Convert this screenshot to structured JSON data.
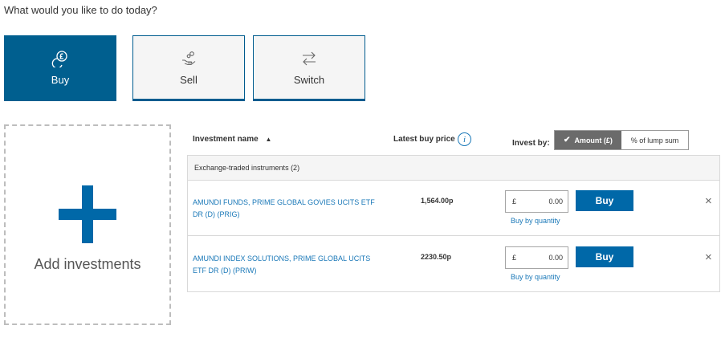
{
  "prompt": "What would you like to do today?",
  "actions": {
    "buy": {
      "label": "Buy",
      "icon": "coin-pound-icon",
      "active": true
    },
    "sell": {
      "label": "Sell",
      "icon": "hand-coins-icon"
    },
    "switch": {
      "label": "Switch",
      "icon": "swap-arrows-icon"
    }
  },
  "add_investments": {
    "label": "Add investments",
    "icon": "plus-icon"
  },
  "table": {
    "headers": {
      "name": "Investment name",
      "sort_indicator": "▲",
      "price": "Latest buy price",
      "info": "i",
      "invest_by": "Invest by:"
    },
    "toggle": {
      "amount": "Amount (£)",
      "percent": "% of lump sum"
    },
    "group_label": "Exchange-traded instruments (2)",
    "rows": [
      {
        "name": "AMUNDI FUNDS, PRIME GLOBAL GOVIES UCITS ETF DR (D) (PRIG)",
        "price": "1,564.00p",
        "currency": "£",
        "amount": "0.00",
        "qty_link": "Buy by quantity",
        "buy_label": "Buy",
        "remove": "×"
      },
      {
        "name": "AMUNDI INDEX SOLUTIONS, PRIME GLOBAL UCITS ETF DR (D) (PRIW)",
        "price": "2230.50p",
        "currency": "£",
        "amount": "0.00",
        "qty_link": "Buy by quantity",
        "buy_label": "Buy",
        "remove": "×"
      }
    ]
  },
  "colors": {
    "brand_blue": "#005f8f",
    "link_blue": "#1a78b8",
    "button_blue": "#0068a8"
  }
}
